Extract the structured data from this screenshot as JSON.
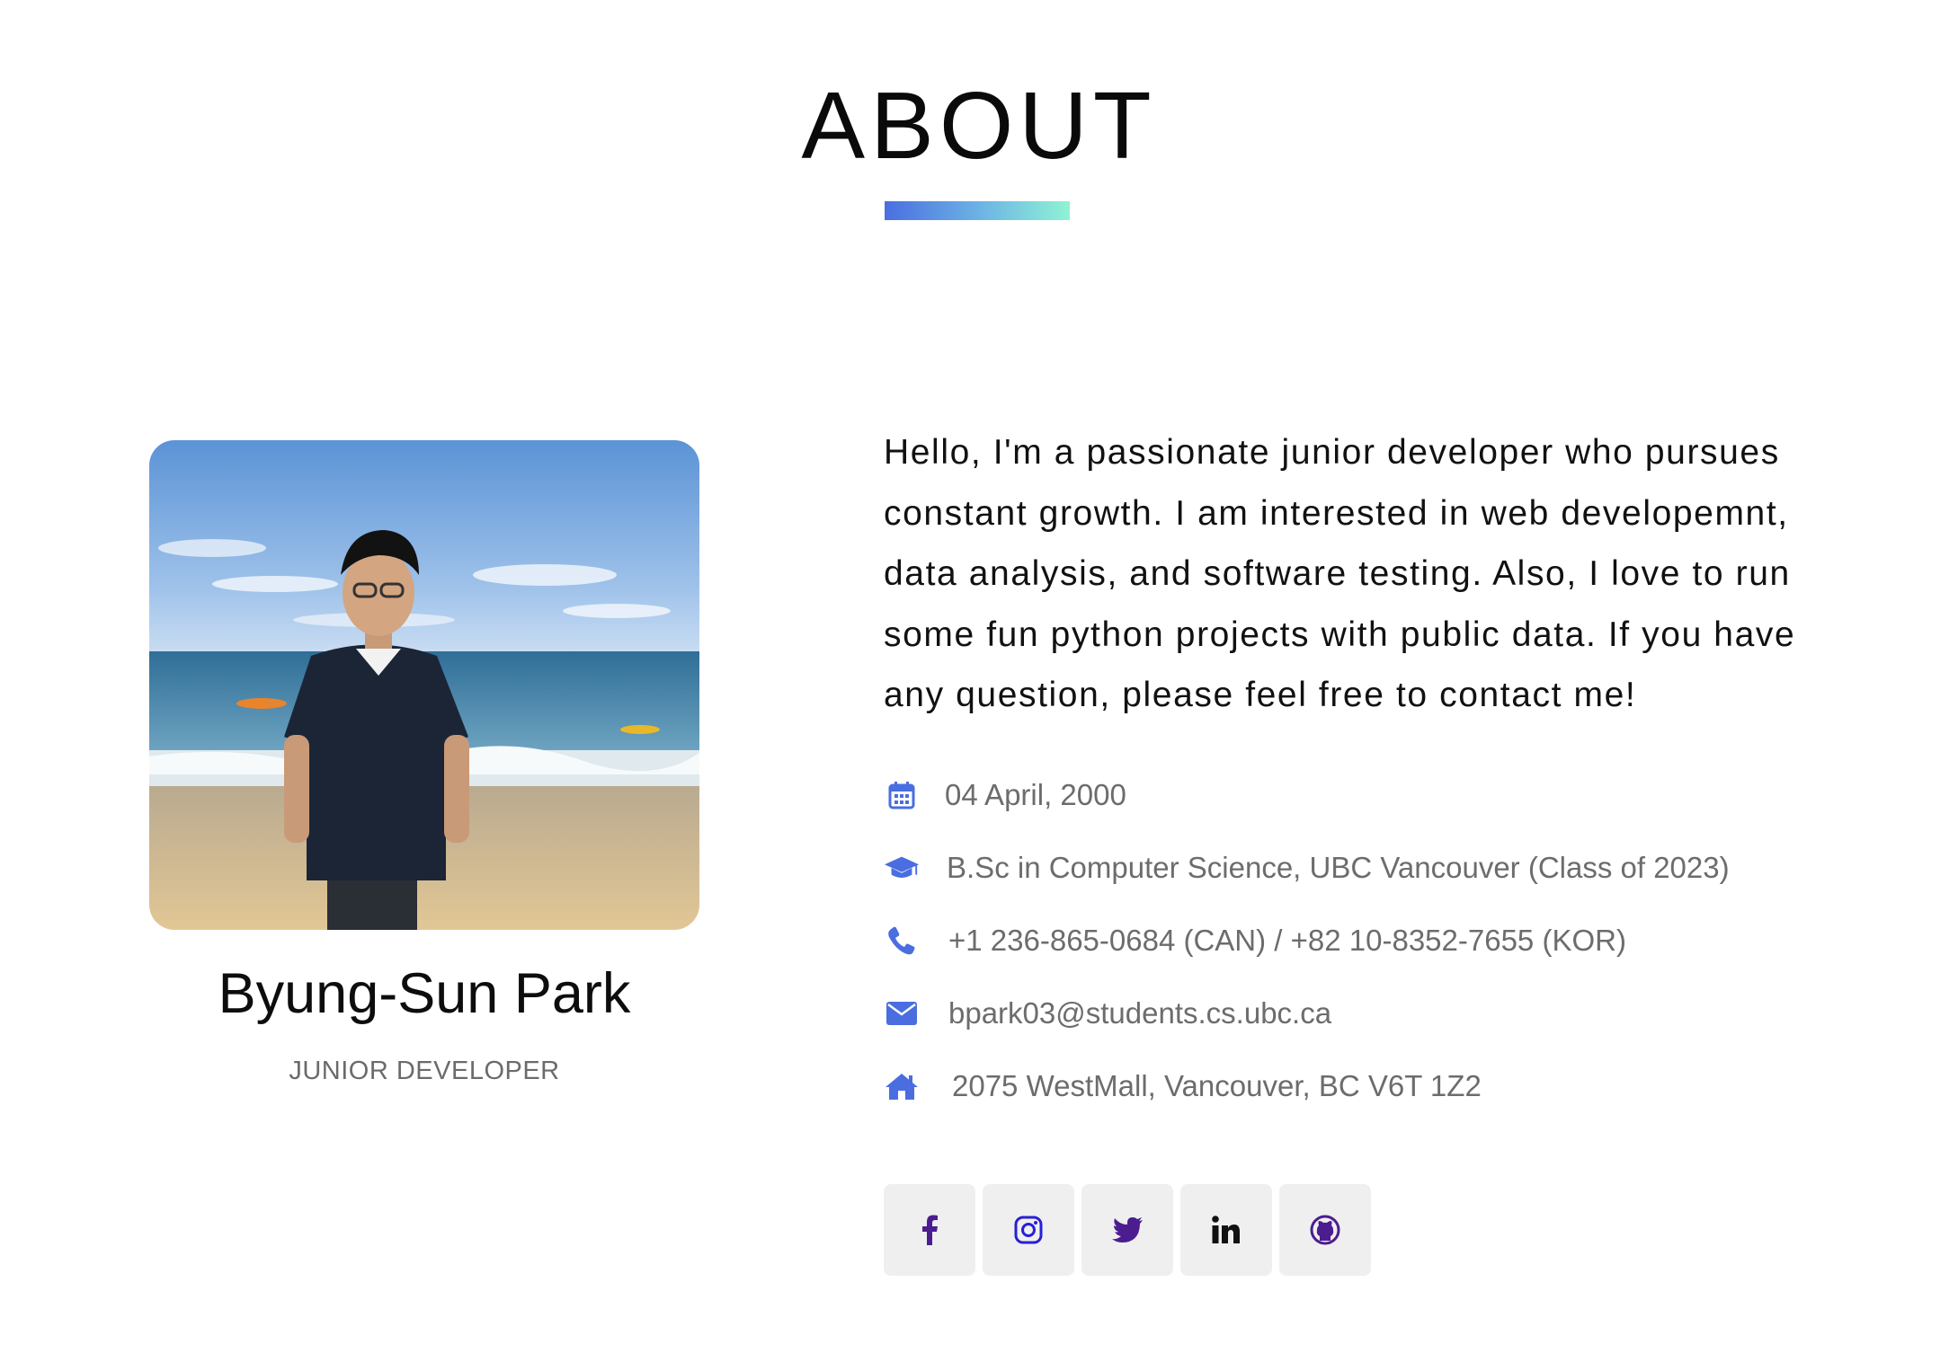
{
  "section": {
    "title": "ABOUT",
    "accent_gradient": [
      "#4a6ee0",
      "#8ff3d3"
    ]
  },
  "profile": {
    "name": "Byung-Sun Park",
    "role": "JUNIOR DEVELOPER"
  },
  "bio": "Hello, I'm a passionate junior developer who pursues constant growth. I am interested in web developemnt, data analysis, and software testing. Also, I love to run some fun python projects with public data. If you have any question, please feel free to contact me!",
  "info": {
    "icon_color": "#4a6ee0",
    "items": [
      {
        "icon": "calendar-icon",
        "text": "04 April, 2000"
      },
      {
        "icon": "graduation-cap-icon",
        "text": "B.Sc in Computer Science, UBC Vancouver (Class of 2023)"
      },
      {
        "icon": "phone-icon",
        "text": "+1 236-865-0684 (CAN) / +82 10-8352-7655 (KOR)"
      },
      {
        "icon": "envelope-icon",
        "text": "bpark03@students.cs.ubc.ca"
      },
      {
        "icon": "home-icon",
        "text": "2075 WestMall, Vancouver, BC V6T 1Z2"
      }
    ]
  },
  "socials": {
    "background": "#efefef",
    "items": [
      {
        "icon": "facebook-icon",
        "color": "#4b1d8f"
      },
      {
        "icon": "instagram-icon",
        "color": "#2a1fd6"
      },
      {
        "icon": "twitter-icon",
        "color": "#4b1d8f"
      },
      {
        "icon": "linkedin-icon",
        "color": "#111111"
      },
      {
        "icon": "github-icon",
        "color": "#4b1d8f"
      }
    ]
  }
}
